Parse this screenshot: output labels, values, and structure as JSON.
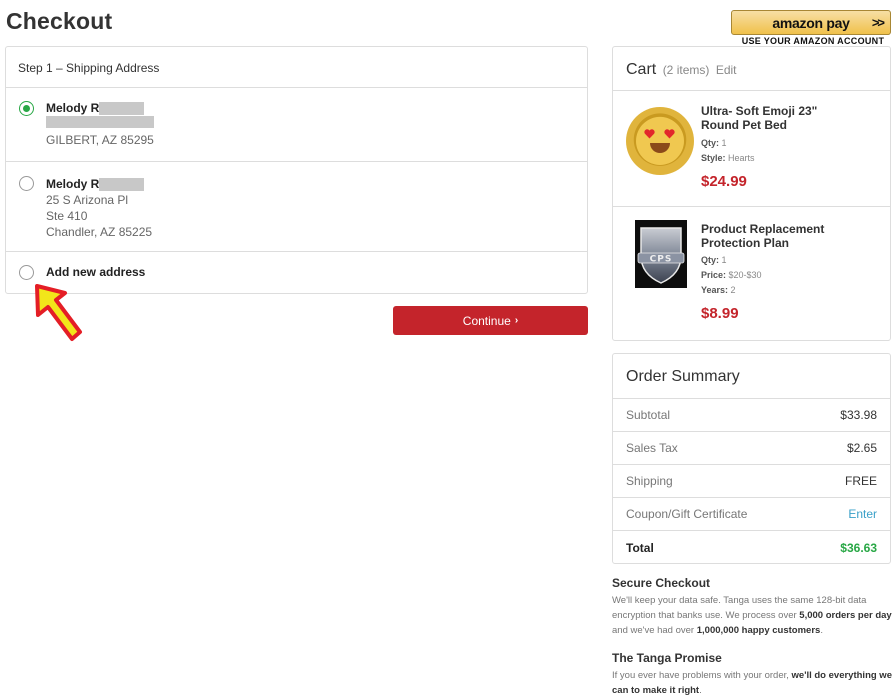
{
  "page": {
    "title": "Checkout"
  },
  "amazon_pay": {
    "logo_text": "amazon pay",
    "chevrons": ">>",
    "subtitle": "USE YOUR AMAZON ACCOUNT"
  },
  "shipping": {
    "header": "Step 1 – Shipping Address",
    "addresses": [
      {
        "name": "Melody R",
        "lines": [
          "GILBERT, AZ 85295"
        ],
        "selected": true
      },
      {
        "name": "Melody R",
        "lines": [
          "25 S Arizona Pl",
          "Ste 410",
          "Chandler, AZ 85225"
        ],
        "selected": false
      }
    ],
    "add_new_label": "Add new address",
    "continue_label": "Continue",
    "continue_chevron": "›"
  },
  "cart": {
    "title": "Cart",
    "count": "(2 items)",
    "edit_label": "Edit",
    "items": [
      {
        "name": "Ultra- Soft Emoji 23\" Round Pet Bed",
        "meta": [
          {
            "label": "Qty:",
            "value": "1"
          },
          {
            "label": "Style:",
            "value": "Hearts"
          }
        ],
        "price": "$24.99",
        "image_icon": "emoji-pet-bed-image"
      },
      {
        "name": "Product Replacement Protection Plan",
        "meta": [
          {
            "label": "Qty:",
            "value": "1"
          },
          {
            "label": "Price:",
            "value": "$20-$30"
          },
          {
            "label": "Years:",
            "value": "2"
          }
        ],
        "price": "$8.99",
        "image_icon": "cps-shield-image",
        "image_text": "CPS"
      }
    ]
  },
  "summary": {
    "title": "Order Summary",
    "rows": [
      {
        "label": "Subtotal",
        "value": "$33.98"
      },
      {
        "label": "Sales Tax",
        "value": "$2.65"
      },
      {
        "label": "Shipping",
        "value": "FREE"
      },
      {
        "label": "Coupon/Gift Certificate",
        "value": "Enter"
      }
    ],
    "total_label": "Total",
    "total_value": "$36.63"
  },
  "secure": {
    "title": "Secure Checkout",
    "text_1": "We'll keep your data safe. Tanga uses the same 128-bit data encryption that banks use. We process over ",
    "bold_1": "5,000 orders per day",
    "text_2": " and we've had over ",
    "bold_2": "1,000,000 happy customers",
    "text_3": "."
  },
  "promise": {
    "title": "The Tanga Promise",
    "text_1": "If you ever have problems with your order, ",
    "bold_1": "we'll do everything we can to make it right",
    "text_2": "."
  },
  "colors": {
    "brand_red": "#c4242b",
    "success_green": "#28a745",
    "link_blue": "#3aa0c8",
    "amazon_gold": "#f0c14b"
  }
}
